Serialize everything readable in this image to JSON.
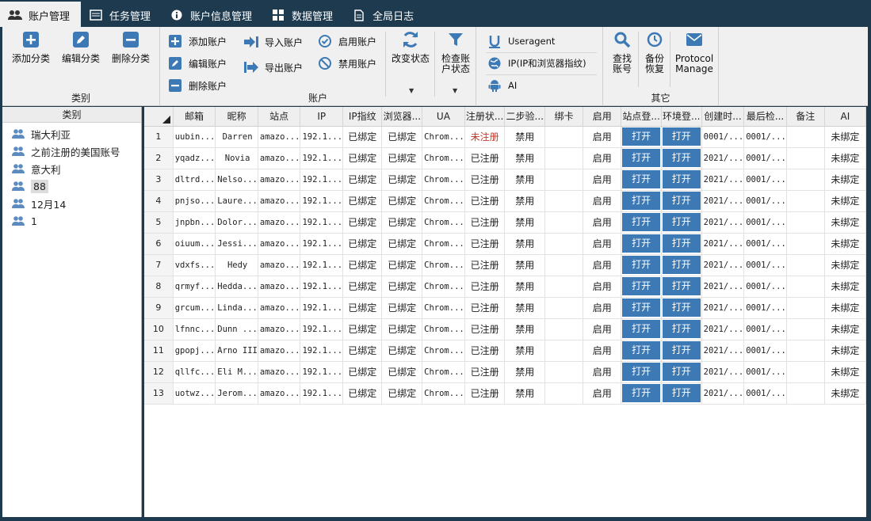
{
  "tabs": [
    {
      "label": "账户管理",
      "icon": "users-icon",
      "active": true
    },
    {
      "label": "任务管理",
      "icon": "task-icon"
    },
    {
      "label": "账户信息管理",
      "icon": "info-icon"
    },
    {
      "label": "数据管理",
      "icon": "grid-icon"
    },
    {
      "label": "全局日志",
      "icon": "document-icon"
    }
  ],
  "ribbon": {
    "category_group": {
      "title": "类别",
      "add": "添加分类",
      "edit": "编辑分类",
      "delete": "删除分类"
    },
    "account_group": {
      "title": "账户",
      "add": "添加账户",
      "edit": "编辑账户",
      "delete": "删除账户",
      "import": "导入账户",
      "export": "导出账户",
      "enable": "启用账户",
      "disable": "禁用账户",
      "change_status": "改变状态",
      "check_status": "检查账户状态"
    },
    "fingerprint": {
      "useragent": "Useragent",
      "ip": "IP(IP和浏览器指纹)",
      "ai": "AI"
    },
    "other_group": {
      "title": "其它",
      "find": "查找账号",
      "backup": "备份恢复",
      "protocol": "Protocol Manage"
    }
  },
  "categories": {
    "title": "类别",
    "items": [
      "瑞大利亚",
      "之前注册的美国账号",
      "意大利",
      "88",
      "12月14",
      "1"
    ],
    "selected": 3
  },
  "table": {
    "columns": [
      "邮箱",
      "昵称",
      "站点",
      "IP",
      "IP指纹",
      "浏览器...",
      "UA",
      "注册状...",
      "二步验...",
      "绑卡",
      "启用",
      "站点登...",
      "环境登...",
      "创建时...",
      "最后检...",
      "备注",
      "AI"
    ],
    "rows": [
      [
        "1",
        "uubin...",
        "Darren",
        "amazo...",
        "192.1...",
        "已绑定",
        "已绑定",
        "Chrom...",
        "未注册",
        "禁用",
        "",
        "启用",
        "打开",
        "打开",
        "0001/...",
        "0001/...",
        "",
        "未绑定"
      ],
      [
        "2",
        "yqadz...",
        "Novia",
        "amazo...",
        "192.1...",
        "已绑定",
        "已绑定",
        "Chrom...",
        "已注册",
        "禁用",
        "",
        "启用",
        "打开",
        "打开",
        "2021/...",
        "0001/...",
        "",
        "未绑定"
      ],
      [
        "3",
        "dltrd...",
        "Nelso...",
        "amazo...",
        "192.1...",
        "已绑定",
        "已绑定",
        "Chrom...",
        "已注册",
        "禁用",
        "",
        "启用",
        "打开",
        "打开",
        "2021/...",
        "0001/...",
        "",
        "未绑定"
      ],
      [
        "4",
        "pnjso...",
        "Laure...",
        "amazo...",
        "192.1...",
        "已绑定",
        "已绑定",
        "Chrom...",
        "已注册",
        "禁用",
        "",
        "启用",
        "打开",
        "打开",
        "2021/...",
        "0001/...",
        "",
        "未绑定"
      ],
      [
        "5",
        "jnpbn...",
        "Dolor...",
        "amazo...",
        "192.1...",
        "已绑定",
        "已绑定",
        "Chrom...",
        "已注册",
        "禁用",
        "",
        "启用",
        "打开",
        "打开",
        "2021/...",
        "0001/...",
        "",
        "未绑定"
      ],
      [
        "6",
        "oiuum...",
        "Jessi...",
        "amazo...",
        "192.1...",
        "已绑定",
        "已绑定",
        "Chrom...",
        "已注册",
        "禁用",
        "",
        "启用",
        "打开",
        "打开",
        "2021/...",
        "0001/...",
        "",
        "未绑定"
      ],
      [
        "7",
        "vdxfs...",
        "Hedy",
        "amazo...",
        "192.1...",
        "已绑定",
        "已绑定",
        "Chrom...",
        "已注册",
        "禁用",
        "",
        "启用",
        "打开",
        "打开",
        "2021/...",
        "0001/...",
        "",
        "未绑定"
      ],
      [
        "8",
        "qrmyf...",
        "Hedda...",
        "amazo...",
        "192.1...",
        "已绑定",
        "已绑定",
        "Chrom...",
        "已注册",
        "禁用",
        "",
        "启用",
        "打开",
        "打开",
        "2021/...",
        "0001/...",
        "",
        "未绑定"
      ],
      [
        "9",
        "grcum...",
        "Linda...",
        "amazo...",
        "192.1...",
        "已绑定",
        "已绑定",
        "Chrom...",
        "已注册",
        "禁用",
        "",
        "启用",
        "打开",
        "打开",
        "2021/...",
        "0001/...",
        "",
        "未绑定"
      ],
      [
        "10",
        "lfnnc...",
        "Dunn ...",
        "amazo...",
        "192.1...",
        "已绑定",
        "已绑定",
        "Chrom...",
        "已注册",
        "禁用",
        "",
        "启用",
        "打开",
        "打开",
        "2021/...",
        "0001/...",
        "",
        "未绑定"
      ],
      [
        "11",
        "gpopj...",
        "Arno III",
        "amazo...",
        "192.1...",
        "已绑定",
        "已绑定",
        "Chrom...",
        "已注册",
        "禁用",
        "",
        "启用",
        "打开",
        "打开",
        "2021/...",
        "0001/...",
        "",
        "未绑定"
      ],
      [
        "12",
        "qllfc...",
        "Eli M...",
        "amazo...",
        "192.1...",
        "已绑定",
        "已绑定",
        "Chrom...",
        "已注册",
        "禁用",
        "",
        "启用",
        "打开",
        "打开",
        "2021/...",
        "0001/...",
        "",
        "未绑定"
      ],
      [
        "13",
        "uotwz...",
        "Jerom...",
        "amazo...",
        "192.1...",
        "已绑定",
        "已绑定",
        "Chrom...",
        "已注册",
        "禁用",
        "",
        "启用",
        "打开",
        "打开",
        "2021/...",
        "0001/...",
        "",
        "未绑定"
      ]
    ]
  },
  "colors": {
    "accent": "#3d7ab5",
    "window_bg": "#1e3a4f",
    "unregistered": "#c0392b"
  }
}
